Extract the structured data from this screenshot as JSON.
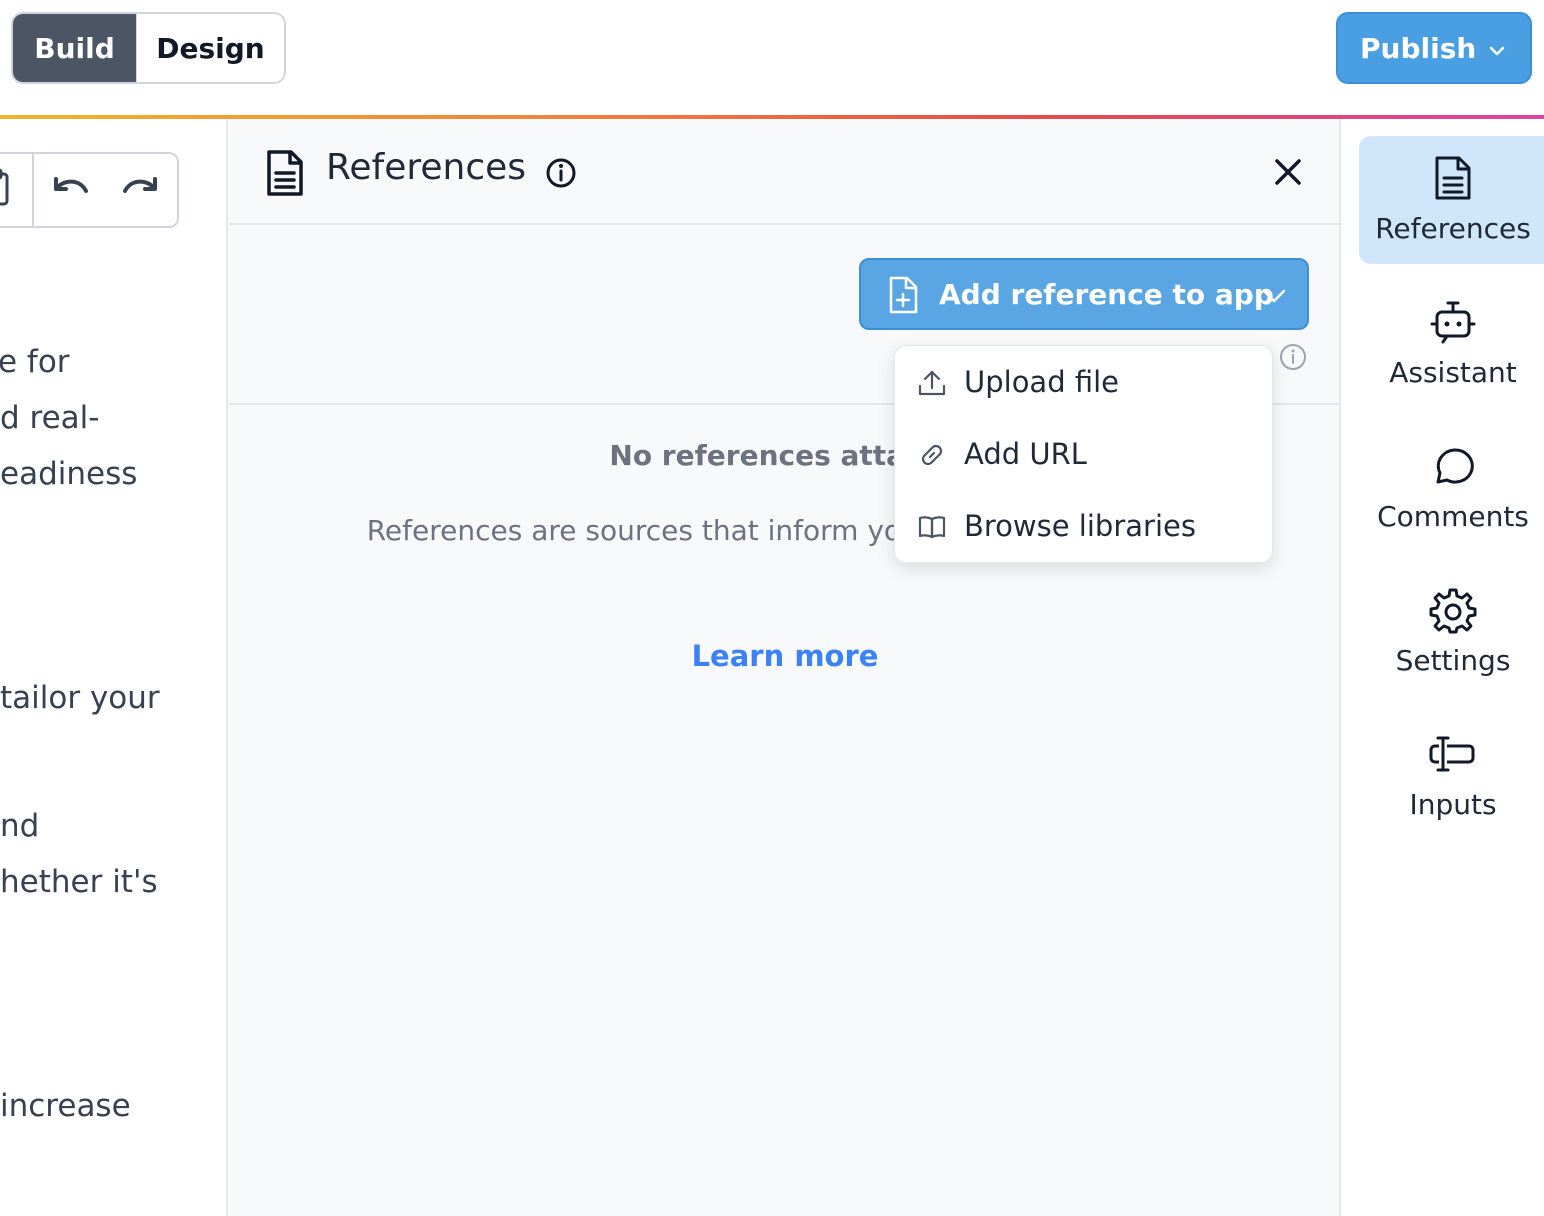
{
  "topbar": {
    "build_label": "Build",
    "design_label": "Design",
    "publish_label": "Publish"
  },
  "editor_fragments": [
    "e for",
    "d real-",
    "eadiness",
    "tailor your",
    "nd",
    "hether it's",
    "increase"
  ],
  "panel": {
    "title": "References",
    "add_button_label": "Add reference to app",
    "empty_title": "No references attache",
    "empty_desc": "References are sources that inform your ap specific context",
    "learn_more": "Learn more"
  },
  "menu": {
    "items": [
      {
        "label": "Upload file",
        "icon": "upload-icon"
      },
      {
        "label": "Add URL",
        "icon": "link-icon"
      },
      {
        "label": "Browse libraries",
        "icon": "book-icon"
      }
    ]
  },
  "rail": {
    "items": [
      {
        "label": "References",
        "icon": "document-icon",
        "active": true
      },
      {
        "label": "Assistant",
        "icon": "robot-icon",
        "active": false
      },
      {
        "label": "Comments",
        "icon": "chat-bubble-icon",
        "active": false
      },
      {
        "label": "Settings",
        "icon": "gear-icon",
        "active": false
      },
      {
        "label": "Inputs",
        "icon": "text-cursor-input-icon",
        "active": false
      }
    ]
  },
  "colors": {
    "primary": "#4a9fe3",
    "build_active": "#4b5563",
    "link": "#3b82f6",
    "rail_active": "#cfe6fb"
  }
}
